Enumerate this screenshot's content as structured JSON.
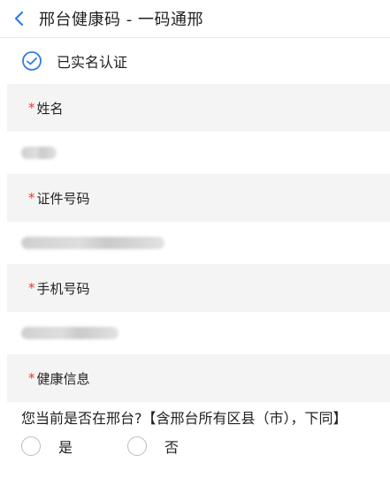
{
  "header": {
    "title": "邢台健康码 - 一码通邢",
    "back_icon": "chevron-left-icon"
  },
  "verification": {
    "text": "已实名认证",
    "icon": "check-circle-icon",
    "icon_color": "#2e7de6"
  },
  "fields": [
    {
      "required_mark": "*",
      "label": "姓名"
    },
    {
      "required_mark": "*",
      "label": "证件号码"
    },
    {
      "required_mark": "*",
      "label": "手机号码"
    },
    {
      "required_mark": "*",
      "label": "健康信息"
    }
  ],
  "question": {
    "text": "您当前是否在邢台?【含邢台所有区县（市），下同】",
    "options": [
      "是",
      "否"
    ]
  },
  "colors": {
    "accent": "#2e7de6",
    "required": "#e53935",
    "section_bg": "#f4f4f4"
  }
}
